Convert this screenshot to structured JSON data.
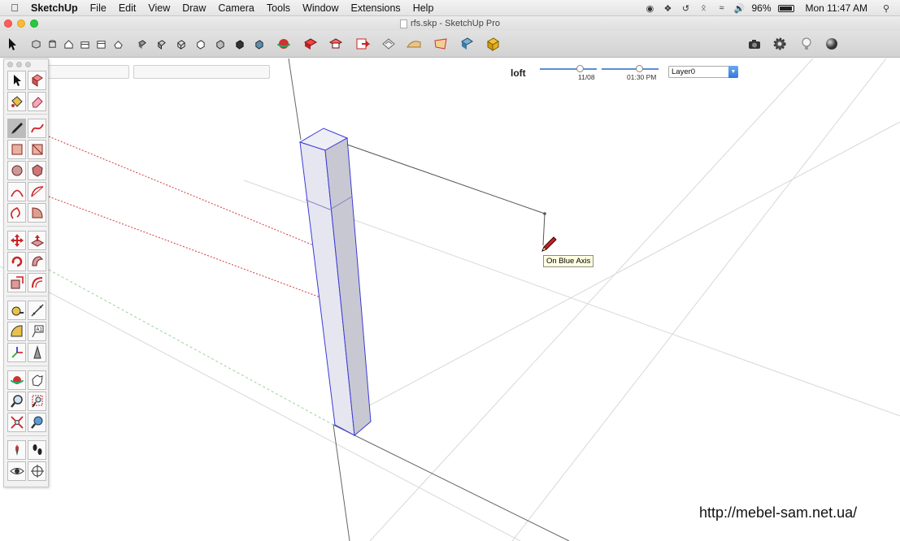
{
  "menubar": {
    "apple_icon": "apple-icon",
    "app_name": "SketchUp",
    "items": [
      "File",
      "Edit",
      "View",
      "Draw",
      "Camera",
      "Tools",
      "Window",
      "Extensions",
      "Help"
    ],
    "battery_percent": "96%",
    "clock": "Mon 11:47 AM"
  },
  "window": {
    "title": "rfs.skp - SketchUp Pro"
  },
  "toolbar": {
    "loft_label": "loft",
    "date_label": "11/08",
    "time_label": "01:30 PM",
    "date_slider_fraction": 0.7,
    "time_slider_fraction": 0.65,
    "layer_value": "Layer0"
  },
  "canvas": {
    "tooltip": "On Blue Axis",
    "colors": {
      "red_axis": "#d33b3b",
      "green_axis": "#9ad19a",
      "blue_axis": "#3b3bd6",
      "edge": "#555555",
      "face_light": "#e6e6f0",
      "face_dark": "#c8c8d2"
    }
  },
  "watermark": "http://mebel-sam.net.ua/"
}
